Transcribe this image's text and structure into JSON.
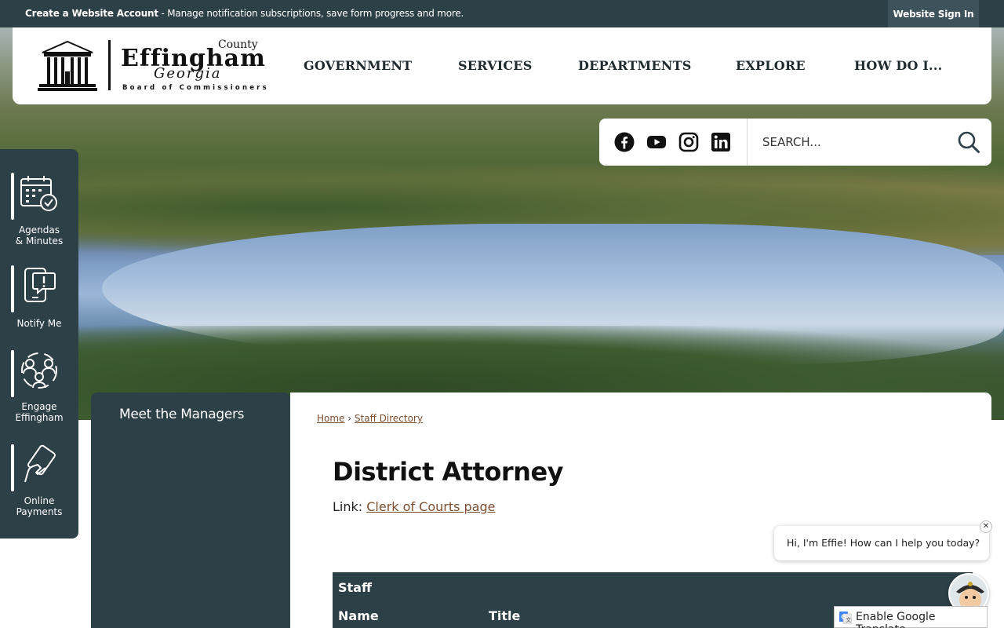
{
  "topbar": {
    "account_bold": "Create a Website Account",
    "account_rest": " - Manage notification subscriptions, save form progress and more.",
    "signin": "Website Sign In"
  },
  "logo": {
    "county": "County",
    "name": "Effingham",
    "script": "Georgia",
    "board": "Board of Commissioners"
  },
  "nav": [
    "GOVERNMENT",
    "SERVICES",
    "DEPARTMENTS",
    "EXPLORE",
    "HOW DO I..."
  ],
  "search": {
    "placeholder": "SEARCH..."
  },
  "social": [
    "facebook-icon",
    "youtube-icon",
    "instagram-icon",
    "linkedin-icon"
  ],
  "quick_links": [
    {
      "line1": "Agendas",
      "line2": "& Minutes",
      "icon": "calendar-check-icon"
    },
    {
      "line1": "Notify Me",
      "line2": "",
      "icon": "phone-alert-icon"
    },
    {
      "line1": "Engage",
      "line2": "Effingham",
      "icon": "people-group-icon"
    },
    {
      "line1": "Online",
      "line2": "Payments",
      "icon": "card-payment-icon"
    }
  ],
  "subnav": {
    "item": "Meet the Managers"
  },
  "breadcrumb": {
    "home": "Home",
    "sep": "›",
    "current": "Staff Directory"
  },
  "page": {
    "title": "District Attorney",
    "link_prefix": "Link: ",
    "link_text": "Clerk of Courts page"
  },
  "staff_table": {
    "caption": "Staff",
    "col_name": "Name",
    "col_title": "Title"
  },
  "chat": {
    "message": "Hi, I'm Effie! How can I help you today?",
    "close": "✕"
  },
  "translate": {
    "label": "Enable Google Translate"
  }
}
